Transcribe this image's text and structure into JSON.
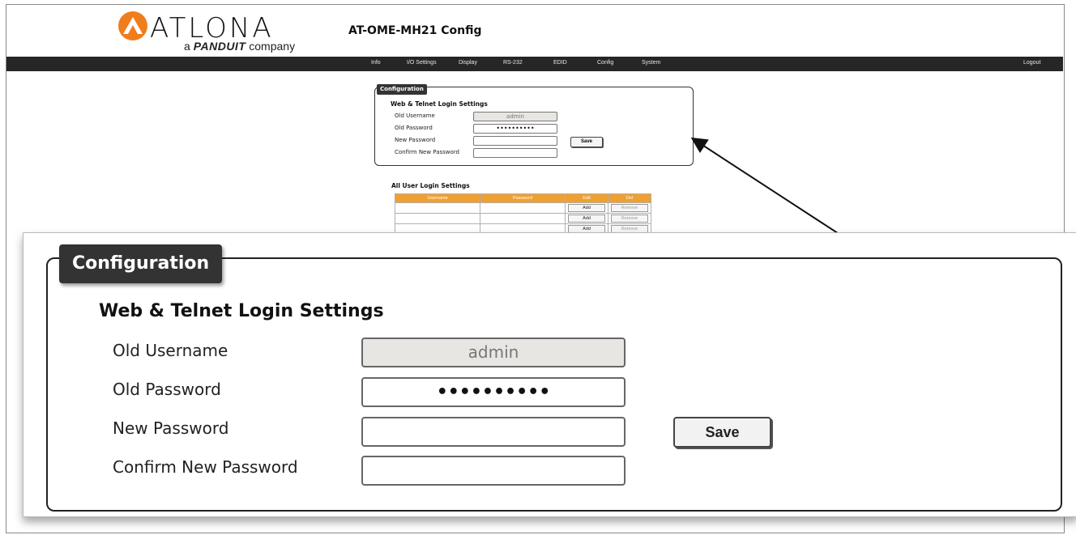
{
  "brand": {
    "name": "ATLONA",
    "tagline_prefix": "a",
    "tagline_brand": "PANDUIT",
    "tagline_suffix": "company"
  },
  "app_title": "AT-OME-MH21  Config",
  "nav": {
    "items": [
      "Info",
      "I/O Settings",
      "Display",
      "RS-232",
      "EDID",
      "Config",
      "System"
    ],
    "logout": "Logout"
  },
  "config": {
    "tab_label": "Configuration",
    "section_title": "Web & Telnet Login Settings",
    "old_username_label": "Old Username",
    "old_username_value": "admin",
    "old_password_label": "Old Password",
    "old_password_value": "••••••••••",
    "new_password_label": "New Password",
    "new_password_value": "",
    "confirm_password_label": "Confirm New Password",
    "confirm_password_value": "",
    "save_label": "Save"
  },
  "users": {
    "title": "All User Login Settings",
    "columns": [
      "Username",
      "Password",
      "Edit",
      "Del"
    ],
    "rows": [
      {
        "username": "",
        "password": "",
        "edit": "Add",
        "del": "Remove"
      },
      {
        "username": "",
        "password": "",
        "edit": "Add",
        "del": "Remove"
      },
      {
        "username": "",
        "password": "",
        "edit": "Add",
        "del": "Remove"
      }
    ]
  },
  "colors": {
    "navbar": "#262626",
    "table_header": "#f0a030",
    "logo_accent": "#f07d1c",
    "panel_tab": "#333333"
  }
}
